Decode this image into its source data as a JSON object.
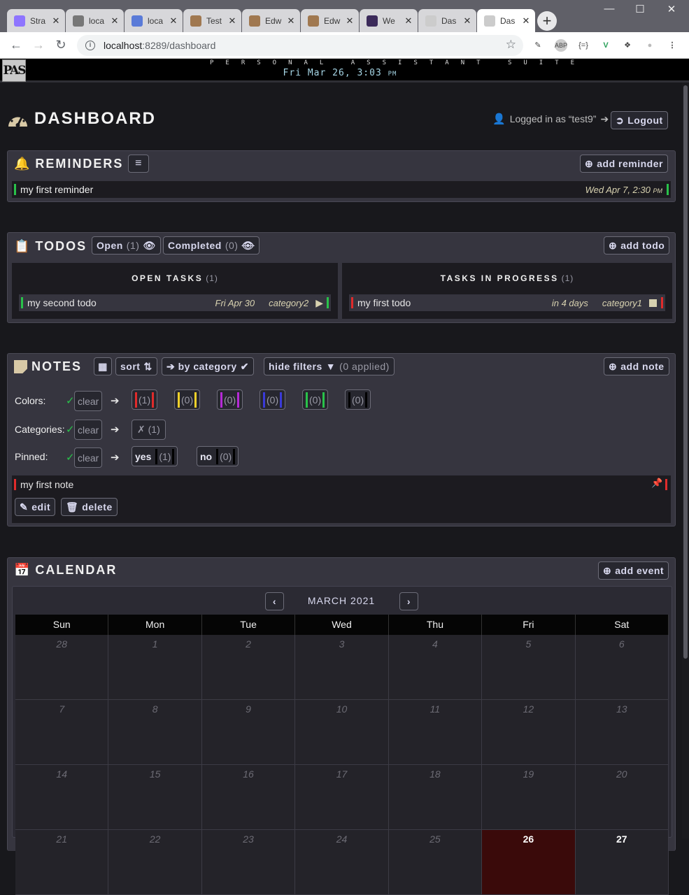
{
  "browser": {
    "tabs": [
      {
        "label": "Stra",
        "icon": "strapi-icon",
        "color": "#8e75ff"
      },
      {
        "label": "loca",
        "icon": "gear-icon",
        "color": "#777777"
      },
      {
        "label": "loca",
        "icon": "graphql-icon",
        "color": "#5a7bd8"
      },
      {
        "label": "Test",
        "icon": "flask-icon",
        "color": "#a07850"
      },
      {
        "label": "Edw",
        "icon": "flask-icon",
        "color": "#a07850"
      },
      {
        "label": "Edw",
        "icon": "flask-icon",
        "color": "#a07850"
      },
      {
        "label": "We",
        "icon": "app-icon",
        "color": "#3b2a5a"
      },
      {
        "label": "Das",
        "icon": "pas-icon",
        "color": "#cccccc"
      },
      {
        "label": "Das",
        "icon": "pas-icon",
        "color": "#cccccc"
      }
    ],
    "url_host": "localhost",
    "url_path": ":8289/dashboard"
  },
  "app": {
    "logo": "PAS",
    "suite_name": "PERSONAL ASSISTANT SUITE",
    "clock": "Fri Mar 26, 3:03",
    "clock_suffix": "PM"
  },
  "page": {
    "title": "DASHBOARD",
    "logged_in_text": "Logged in as “test9”",
    "logout_label": "Logout"
  },
  "reminders": {
    "title": "REMINDERS",
    "add_label": "add reminder",
    "items": [
      {
        "text": "my first reminder",
        "date": "Wed Apr 7, 2:30",
        "date_suffix": "PM",
        "color": "#29c24a"
      }
    ]
  },
  "todos": {
    "title": "TODOS",
    "open_label": "Open",
    "open_count": "(1)",
    "completed_label": "Completed",
    "completed_count": "(0)",
    "add_label": "add todo",
    "open_column": {
      "title": "OPEN TASKS",
      "count": "(1)"
    },
    "progress_column": {
      "title": "TASKS IN PROGRESS",
      "count": "(1)"
    },
    "open_items": [
      {
        "text": "my second todo",
        "due": "Fri Apr 30",
        "category": "category2",
        "color": "#29c24a"
      }
    ],
    "progress_items": [
      {
        "text": "my first todo",
        "due": "in 4 days",
        "category": "category1",
        "color": "#e02b2b"
      }
    ]
  },
  "notes": {
    "title": "NOTES",
    "sort_label": "sort",
    "group_label": "➔ by category",
    "filters_label": "hide filters",
    "filters_applied": "(0 applied)",
    "add_label": "add note",
    "filters": {
      "colors_label": "Colors:",
      "categories_label": "Categories:",
      "pinned_label": "Pinned:",
      "clear_label": "clear",
      "color_chips": [
        {
          "count": "(1)",
          "color": "#e02b2b"
        },
        {
          "count": "(0)",
          "color": "#f2d12a"
        },
        {
          "count": "(0)",
          "color": "#b52ad6"
        },
        {
          "count": "(0)",
          "color": "#3a3ad8"
        },
        {
          "count": "(0)",
          "color": "#29c24a"
        },
        {
          "count": "(0)",
          "color": "#000000"
        }
      ],
      "category_chip": "✗ (1)",
      "pinned_yes": "yes",
      "pinned_yes_count": "(1)",
      "pinned_no": "no",
      "pinned_no_count": "(0)"
    },
    "items": [
      {
        "text": "my first note",
        "color": "#e02b2b",
        "edit_label": "edit",
        "delete_label": "delete"
      }
    ]
  },
  "calendar": {
    "title": "CALENDAR",
    "add_label": "add event",
    "month_label": "MARCH 2021",
    "weekdays": [
      "Sun",
      "Mon",
      "Tue",
      "Wed",
      "Thu",
      "Fri",
      "Sat"
    ],
    "days": [
      "28",
      "1",
      "2",
      "3",
      "4",
      "5",
      "6",
      "7",
      "8",
      "9",
      "10",
      "11",
      "12",
      "13",
      "14",
      "15",
      "16",
      "17",
      "18",
      "19",
      "20",
      "21",
      "22",
      "23",
      "24",
      "25",
      "26",
      "27"
    ],
    "today": "26"
  }
}
